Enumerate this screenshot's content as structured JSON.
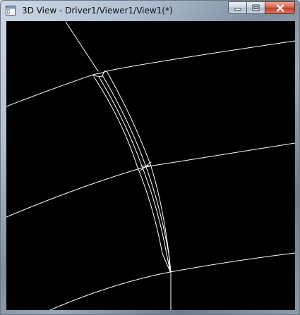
{
  "window": {
    "title": "3D View - Driver1/Viewer1/View1(*)",
    "icon": "app-window-icon",
    "buttons": {
      "minimize_icon": "minimize-icon",
      "maximize_icon": "restore-icon",
      "close_icon": "close-icon"
    }
  },
  "viewport": {
    "background": "#000000",
    "line_color": "#ffffff",
    "content": "wireframe-curves"
  }
}
